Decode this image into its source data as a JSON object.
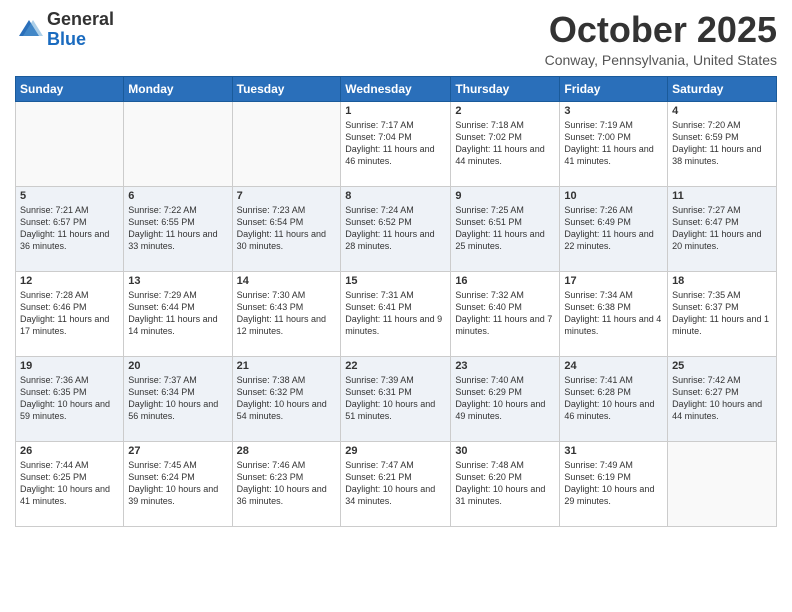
{
  "header": {
    "logo_general": "General",
    "logo_blue": "Blue",
    "month_title": "October 2025",
    "location": "Conway, Pennsylvania, United States"
  },
  "days_of_week": [
    "Sunday",
    "Monday",
    "Tuesday",
    "Wednesday",
    "Thursday",
    "Friday",
    "Saturday"
  ],
  "weeks": [
    [
      {
        "day": "",
        "info": ""
      },
      {
        "day": "",
        "info": ""
      },
      {
        "day": "",
        "info": ""
      },
      {
        "day": "1",
        "info": "Sunrise: 7:17 AM\nSunset: 7:04 PM\nDaylight: 11 hours and 46 minutes."
      },
      {
        "day": "2",
        "info": "Sunrise: 7:18 AM\nSunset: 7:02 PM\nDaylight: 11 hours and 44 minutes."
      },
      {
        "day": "3",
        "info": "Sunrise: 7:19 AM\nSunset: 7:00 PM\nDaylight: 11 hours and 41 minutes."
      },
      {
        "day": "4",
        "info": "Sunrise: 7:20 AM\nSunset: 6:59 PM\nDaylight: 11 hours and 38 minutes."
      }
    ],
    [
      {
        "day": "5",
        "info": "Sunrise: 7:21 AM\nSunset: 6:57 PM\nDaylight: 11 hours and 36 minutes."
      },
      {
        "day": "6",
        "info": "Sunrise: 7:22 AM\nSunset: 6:55 PM\nDaylight: 11 hours and 33 minutes."
      },
      {
        "day": "7",
        "info": "Sunrise: 7:23 AM\nSunset: 6:54 PM\nDaylight: 11 hours and 30 minutes."
      },
      {
        "day": "8",
        "info": "Sunrise: 7:24 AM\nSunset: 6:52 PM\nDaylight: 11 hours and 28 minutes."
      },
      {
        "day": "9",
        "info": "Sunrise: 7:25 AM\nSunset: 6:51 PM\nDaylight: 11 hours and 25 minutes."
      },
      {
        "day": "10",
        "info": "Sunrise: 7:26 AM\nSunset: 6:49 PM\nDaylight: 11 hours and 22 minutes."
      },
      {
        "day": "11",
        "info": "Sunrise: 7:27 AM\nSunset: 6:47 PM\nDaylight: 11 hours and 20 minutes."
      }
    ],
    [
      {
        "day": "12",
        "info": "Sunrise: 7:28 AM\nSunset: 6:46 PM\nDaylight: 11 hours and 17 minutes."
      },
      {
        "day": "13",
        "info": "Sunrise: 7:29 AM\nSunset: 6:44 PM\nDaylight: 11 hours and 14 minutes."
      },
      {
        "day": "14",
        "info": "Sunrise: 7:30 AM\nSunset: 6:43 PM\nDaylight: 11 hours and 12 minutes."
      },
      {
        "day": "15",
        "info": "Sunrise: 7:31 AM\nSunset: 6:41 PM\nDaylight: 11 hours and 9 minutes."
      },
      {
        "day": "16",
        "info": "Sunrise: 7:32 AM\nSunset: 6:40 PM\nDaylight: 11 hours and 7 minutes."
      },
      {
        "day": "17",
        "info": "Sunrise: 7:34 AM\nSunset: 6:38 PM\nDaylight: 11 hours and 4 minutes."
      },
      {
        "day": "18",
        "info": "Sunrise: 7:35 AM\nSunset: 6:37 PM\nDaylight: 11 hours and 1 minute."
      }
    ],
    [
      {
        "day": "19",
        "info": "Sunrise: 7:36 AM\nSunset: 6:35 PM\nDaylight: 10 hours and 59 minutes."
      },
      {
        "day": "20",
        "info": "Sunrise: 7:37 AM\nSunset: 6:34 PM\nDaylight: 10 hours and 56 minutes."
      },
      {
        "day": "21",
        "info": "Sunrise: 7:38 AM\nSunset: 6:32 PM\nDaylight: 10 hours and 54 minutes."
      },
      {
        "day": "22",
        "info": "Sunrise: 7:39 AM\nSunset: 6:31 PM\nDaylight: 10 hours and 51 minutes."
      },
      {
        "day": "23",
        "info": "Sunrise: 7:40 AM\nSunset: 6:29 PM\nDaylight: 10 hours and 49 minutes."
      },
      {
        "day": "24",
        "info": "Sunrise: 7:41 AM\nSunset: 6:28 PM\nDaylight: 10 hours and 46 minutes."
      },
      {
        "day": "25",
        "info": "Sunrise: 7:42 AM\nSunset: 6:27 PM\nDaylight: 10 hours and 44 minutes."
      }
    ],
    [
      {
        "day": "26",
        "info": "Sunrise: 7:44 AM\nSunset: 6:25 PM\nDaylight: 10 hours and 41 minutes."
      },
      {
        "day": "27",
        "info": "Sunrise: 7:45 AM\nSunset: 6:24 PM\nDaylight: 10 hours and 39 minutes."
      },
      {
        "day": "28",
        "info": "Sunrise: 7:46 AM\nSunset: 6:23 PM\nDaylight: 10 hours and 36 minutes."
      },
      {
        "day": "29",
        "info": "Sunrise: 7:47 AM\nSunset: 6:21 PM\nDaylight: 10 hours and 34 minutes."
      },
      {
        "day": "30",
        "info": "Sunrise: 7:48 AM\nSunset: 6:20 PM\nDaylight: 10 hours and 31 minutes."
      },
      {
        "day": "31",
        "info": "Sunrise: 7:49 AM\nSunset: 6:19 PM\nDaylight: 10 hours and 29 minutes."
      },
      {
        "day": "",
        "info": ""
      }
    ]
  ]
}
